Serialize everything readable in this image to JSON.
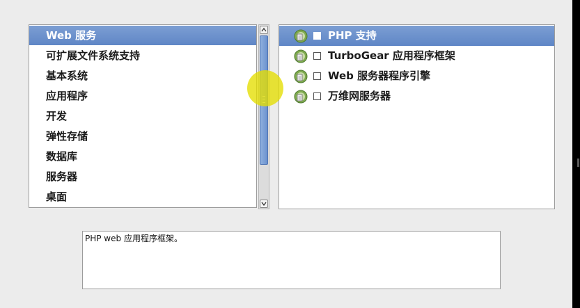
{
  "categories": {
    "selected_index": 0,
    "items": [
      {
        "label": "Web 服务"
      },
      {
        "label": "可扩展文件系统支持"
      },
      {
        "label": "基本系统"
      },
      {
        "label": "应用程序"
      },
      {
        "label": "开发"
      },
      {
        "label": "弹性存储"
      },
      {
        "label": "数据库"
      },
      {
        "label": "服务器"
      },
      {
        "label": "桌面"
      }
    ]
  },
  "scrollbar": {
    "up_icon": "chevron-up-icon",
    "down_icon": "chevron-down-icon",
    "thumb_fraction_visible": 0.7
  },
  "packages": {
    "selected_index": 0,
    "items": [
      {
        "label": "PHP 支持",
        "checked": false,
        "icon": "package-group-icon"
      },
      {
        "label": "TurboGear 应用程序框架",
        "checked": false,
        "icon": "package-group-icon"
      },
      {
        "label": "Web 服务器程序引擎",
        "checked": false,
        "icon": "package-group-icon"
      },
      {
        "label": "万维网服务器",
        "checked": false,
        "icon": "package-group-icon"
      }
    ]
  },
  "description": {
    "text": "PHP web 应用程序框架。"
  },
  "colors": {
    "selection": "#6a8fcb",
    "window_bg": "#ececec",
    "highlight_halo": "#e4de00"
  }
}
